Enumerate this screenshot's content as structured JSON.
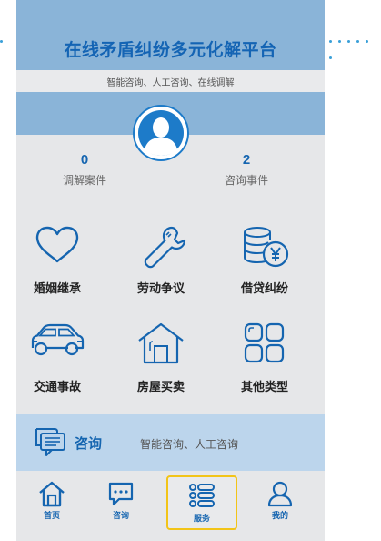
{
  "app": {
    "title": "在线矛盾纠纷多元化解平台",
    "subtitle": "智能咨询、人工咨询、在线调解"
  },
  "stats": [
    {
      "value": "0",
      "label": "调解案件"
    },
    {
      "value": "2",
      "label": "咨询事件"
    }
  ],
  "categories": [
    {
      "label": "婚姻继承",
      "icon": "heart-icon"
    },
    {
      "label": "劳动争议",
      "icon": "wrench-icon"
    },
    {
      "label": "借贷纠纷",
      "icon": "coins-yen-icon"
    },
    {
      "label": "交通事故",
      "icon": "car-icon"
    },
    {
      "label": "房屋买卖",
      "icon": "house-icon"
    },
    {
      "label": "其他类型",
      "icon": "grid-icon"
    }
  ],
  "consult": {
    "label": "咨询",
    "description": "智能咨询、人工咨询",
    "icon": "chat-icon"
  },
  "tabs": [
    {
      "label": "首页",
      "icon": "home-icon"
    },
    {
      "label": "咨询",
      "icon": "message-icon"
    },
    {
      "label": "服务",
      "icon": "list-icon",
      "active": true
    },
    {
      "label": "我的",
      "icon": "user-icon"
    }
  ],
  "colors": {
    "primary": "#1565b0",
    "header_bg": "#8ab4d8",
    "page_bg": "#e6e7e9",
    "consult_bg": "#bcd5ec",
    "active_tab_border": "#f2c418"
  }
}
